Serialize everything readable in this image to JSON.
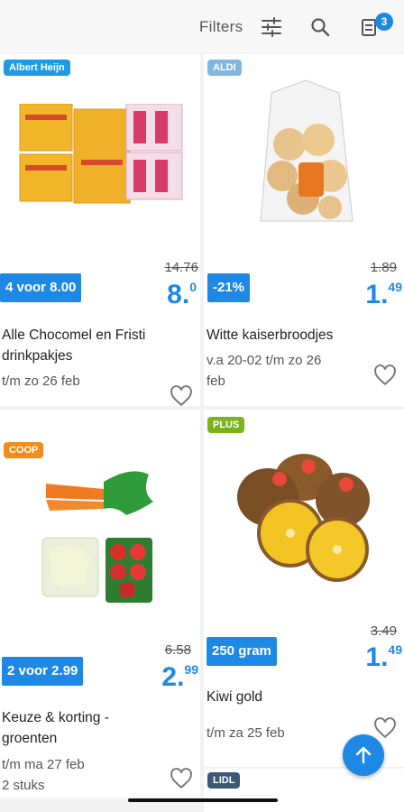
{
  "header": {
    "filters_label": "Filters",
    "filter_icon": "sliders-icon",
    "search_icon": "search-icon",
    "list_icon": "shopping-list-icon",
    "list_count": "3"
  },
  "colors": {
    "accent": "#1e88e5",
    "albert_heijn": "#1f9be3",
    "aldi": "#83b6df",
    "coop": "#f28c1b",
    "plus": "#7bb31a",
    "lidl": "#3d5877"
  },
  "products": [
    {
      "store": "Albert Heijn",
      "promo": "4 voor 8.00",
      "old_price": "14.76",
      "price_main": "8.",
      "price_cents": "0",
      "name_line1": "Alle Chocomel en Fristi",
      "name_line2": "drinkpakjes",
      "date_line1": "t/m zo 26 feb",
      "date_line2": ""
    },
    {
      "store": "ALDI",
      "promo": "-21%",
      "old_price": "1.89",
      "price_main": "1.",
      "price_cents": "49",
      "name_line1": "Witte kaiserbroodjes",
      "name_line2": "",
      "date_line1": "v.a 20-02 t/m zo 26",
      "date_line2": "feb"
    },
    {
      "store": "COOP",
      "promo": "2 voor 2.99",
      "old_price": "6.58",
      "price_main": "2.",
      "price_cents": "99",
      "name_line1": "Keuze & korting -",
      "name_line2": "groenten",
      "date_line1": "t/m ma 27 feb",
      "date_line2": "2 stuks"
    },
    {
      "store": "PLUS",
      "promo": "250 gram",
      "old_price": "3.49",
      "price_main": "1.",
      "price_cents": "49",
      "name_line1": "Kiwi gold",
      "name_line2": "",
      "date_line1": "t/m za 25 feb",
      "date_line2": ""
    },
    {
      "store": "LIDL"
    }
  ],
  "fab_icon": "arrow-up-icon"
}
